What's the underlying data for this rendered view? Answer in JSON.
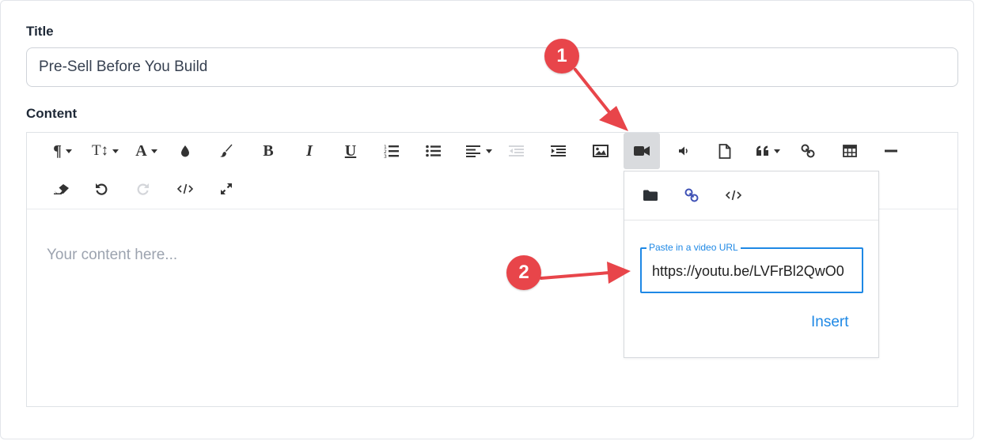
{
  "form": {
    "title_label": "Title",
    "title_value": "Pre-Sell Before You Build",
    "content_label": "Content"
  },
  "editor": {
    "placeholder": "Your content here...",
    "toolbar": {
      "paragraph_format": "¶",
      "font_size": "T↕",
      "font_family": "A",
      "bold": "B",
      "italic": "I",
      "underline": "U"
    }
  },
  "video_popup": {
    "tabs": [
      "folder-icon",
      "link-icon",
      "embed-code-icon"
    ],
    "url_label": "Paste in a video URL",
    "url_value": "https://youtu.be/LVFrBl2QwO0",
    "insert_label": "Insert"
  },
  "annotations": {
    "step1": "1",
    "step2": "2",
    "color": "#e8454a"
  }
}
